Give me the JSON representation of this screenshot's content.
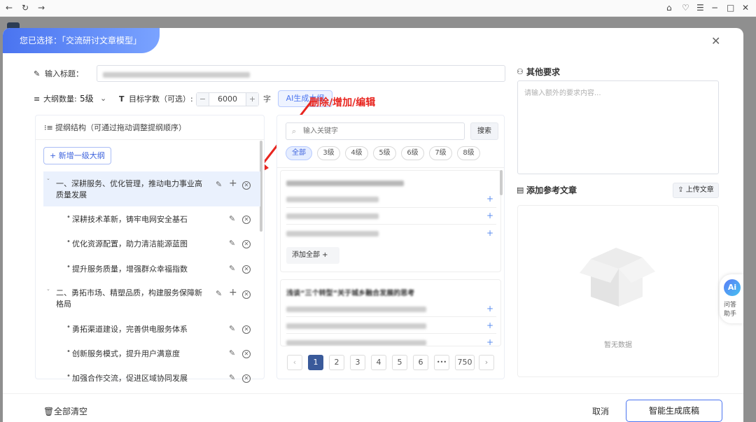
{
  "modal": {
    "banner": "您已选择：「交流研讨文章模型」",
    "close_label": "✕"
  },
  "title_row": {
    "label": "输入标题："
  },
  "outline_count": {
    "label": "大纲数量:",
    "value": "5级"
  },
  "target_words": {
    "label": "目标字数（可选）:",
    "minus": "−",
    "value": "6000",
    "plus": "+",
    "unit": "字"
  },
  "ai_button": "AI生成大纲",
  "annotation": "删除/增加/编辑",
  "outline": {
    "header": "提纲结构（可通过拖动调整提纲顺序）",
    "add_first_level": "新增一级大纲",
    "items": [
      {
        "level": 1,
        "text": "一、深耕服务、优化管理，推动电力事业高质量发展",
        "highlighted": true
      },
      {
        "level": 2,
        "text": "深耕技术革新，铸牢电网安全基石"
      },
      {
        "level": 2,
        "text": "优化资源配置，助力清洁能源蓝图"
      },
      {
        "level": 2,
        "text": "提升服务质量，增强群众幸福指数"
      },
      {
        "level": 1,
        "text": "二、勇拓市场、精塑品质，构建服务保障新格局"
      },
      {
        "level": 2,
        "text": "勇拓渠道建设，完善供电服务体系"
      },
      {
        "level": 2,
        "text": "创新服务模式，提升用户满意度"
      },
      {
        "level": 2,
        "text": "加强合作交流，促进区域协同发展"
      }
    ]
  },
  "search": {
    "placeholder": "输入关键字",
    "button": "搜索",
    "filters": [
      "全部",
      "3级",
      "4级",
      "5级",
      "6级",
      "7级",
      "8级"
    ],
    "add_all": "添加全部"
  },
  "card2_title": "浅谈“三个转型”关于城乡融合发展的思考",
  "pagination": {
    "prev": "‹",
    "pages": [
      "1",
      "2",
      "3",
      "4",
      "5",
      "6"
    ],
    "ellipsis": "•••",
    "last": "750",
    "next": "›"
  },
  "other_req": {
    "title": "其他要求",
    "placeholder": "请输入额外的要求内容..."
  },
  "reference": {
    "title": "添加参考文章",
    "upload": "上传文章",
    "empty": "暂无数据"
  },
  "assistant": {
    "label1": "问答",
    "label2": "助手"
  },
  "footer": {
    "clear_all": "全部清空",
    "cancel": "取消",
    "generate": "智能生成底稿"
  },
  "colors": {
    "accent": "#4a74f0",
    "annotation": "#e8251f",
    "page_active": "#3a5a9a"
  }
}
